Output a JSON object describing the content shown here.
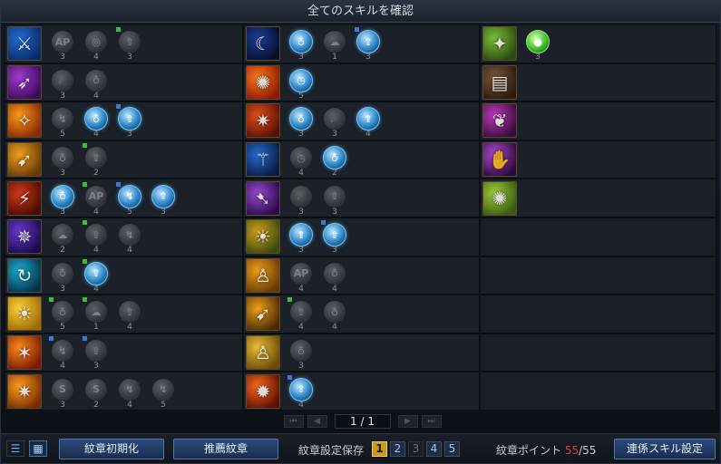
{
  "window": {
    "title": "全てのスキルを確認"
  },
  "skills": [
    {
      "icon": "blade-rush-icon",
      "glyph": "⚔",
      "bg": [
        "#1e6fd0",
        "#0b2a6a"
      ],
      "emblems": [
        {
          "s": "inactive",
          "c": "3",
          "t": "",
          "g": "AP"
        },
        {
          "s": "inactive",
          "c": "4",
          "t": "",
          "g": "◎"
        },
        {
          "s": "inactive",
          "c": "3",
          "t": "g",
          "g": "⇧"
        }
      ]
    },
    {
      "icon": "crescent-moon-icon",
      "glyph": "☾",
      "bg": [
        "#1c3f9a",
        "#070d2a"
      ],
      "emblems": [
        {
          "s": "active",
          "c": "3",
          "t": "",
          "g": "♁"
        },
        {
          "s": "inactive",
          "c": "1",
          "t": "",
          "g": "☁"
        },
        {
          "s": "active",
          "c": "3",
          "t": "b",
          "g": "⇧"
        }
      ]
    },
    {
      "icon": "nature-spirit-icon",
      "glyph": "✦",
      "bg": [
        "#7bbf3a",
        "#2a4a10"
      ],
      "emblems": [
        {
          "s": "green",
          "c": "3",
          "t": "",
          "g": "●"
        }
      ]
    },
    {
      "icon": "shadow-dash-icon",
      "glyph": "➶",
      "bg": [
        "#a03ad0",
        "#3a0c5a"
      ],
      "emblems": [
        {
          "s": "inactive",
          "c": "3",
          "t": "",
          "g": "☄"
        },
        {
          "s": "inactive",
          "c": "4",
          "t": "",
          "g": "♁"
        }
      ]
    },
    {
      "icon": "fire-sun-icon",
      "glyph": "✺",
      "bg": [
        "#ff7a1a",
        "#8a1a04"
      ],
      "emblems": [
        {
          "s": "active",
          "c": "5",
          "t": "",
          "g": "◷"
        }
      ]
    },
    {
      "icon": "spellbook-icon",
      "glyph": "▤",
      "bg": [
        "#7a5a3a",
        "#2a1a10"
      ],
      "emblems": []
    },
    {
      "icon": "flame-kick-icon",
      "glyph": "✧",
      "bg": [
        "#ff9a1a",
        "#8a2a04"
      ],
      "emblems": [
        {
          "s": "inactive",
          "c": "5",
          "t": "",
          "g": "↯"
        },
        {
          "s": "active",
          "c": "4",
          "t": "",
          "g": "♁"
        },
        {
          "s": "active",
          "c": "3",
          "t": "b",
          "g": "⇧"
        }
      ]
    },
    {
      "icon": "flame-leap-icon",
      "glyph": "✷",
      "bg": [
        "#e0501a",
        "#5a1004"
      ],
      "emblems": [
        {
          "s": "active",
          "c": "3",
          "t": "",
          "g": "♁"
        },
        {
          "s": "inactive",
          "c": "3",
          "t": "",
          "g": "☄"
        },
        {
          "s": "active",
          "c": "4",
          "t": "",
          "g": "⇑"
        }
      ]
    },
    {
      "icon": "dark-wings-icon",
      "glyph": "❦",
      "bg": [
        "#c03ac0",
        "#3a0a3a"
      ],
      "emblems": []
    },
    {
      "icon": "golden-strike-icon",
      "glyph": "➹",
      "bg": [
        "#f0a020",
        "#6a3a04"
      ],
      "emblems": [
        {
          "s": "inactive",
          "c": "3",
          "t": "",
          "g": "♁"
        },
        {
          "s": "inactive",
          "c": "2",
          "t": "g",
          "g": "⇧"
        }
      ]
    },
    {
      "icon": "pole-spin-icon",
      "glyph": "⚚",
      "bg": [
        "#2a6ad0",
        "#081a40"
      ],
      "emblems": [
        {
          "s": "inactive",
          "c": "4",
          "t": "",
          "g": "◷"
        },
        {
          "s": "active",
          "c": "2",
          "t": "",
          "g": "♁"
        }
      ]
    },
    {
      "icon": "shadow-grab-icon",
      "glyph": "✋",
      "bg": [
        "#b04ad0",
        "#2a0a3a"
      ],
      "emblems": []
    },
    {
      "icon": "crimson-slash-icon",
      "glyph": "⚡",
      "bg": [
        "#d03a1a",
        "#4a0a04"
      ],
      "emblems": [
        {
          "s": "active",
          "c": "3",
          "t": "",
          "g": "♁"
        },
        {
          "s": "inactive",
          "c": "4",
          "t": "g",
          "g": "AP"
        },
        {
          "s": "active",
          "c": "5",
          "t": "b",
          "g": "↯"
        },
        {
          "s": "active",
          "c": "3",
          "t": "",
          "g": "⇧"
        }
      ]
    },
    {
      "icon": "violet-kick-icon",
      "glyph": "➷",
      "bg": [
        "#9a4ad0",
        "#2a0a4a"
      ],
      "emblems": [
        {
          "s": "inactive",
          "c": "3",
          "t": "",
          "g": "☄"
        },
        {
          "s": "inactive",
          "c": "3",
          "t": "",
          "g": "⇧"
        }
      ]
    },
    {
      "icon": "radiant-burst-icon",
      "glyph": "✺",
      "bg": [
        "#a0d03a",
        "#3a5a10"
      ],
      "emblems": []
    },
    {
      "icon": "purple-spiral-icon",
      "glyph": "✵",
      "bg": [
        "#6a3ad0",
        "#1a0a4a"
      ],
      "emblems": [
        {
          "s": "inactive",
          "c": "2",
          "t": "",
          "g": "☁"
        },
        {
          "s": "inactive",
          "c": "4",
          "t": "g",
          "g": "⇧"
        },
        {
          "s": "inactive",
          "c": "4",
          "t": "",
          "g": "↯"
        }
      ]
    },
    {
      "icon": "golden-aura-icon",
      "glyph": "☀",
      "bg": [
        "#d0a01a",
        "#3a4a10"
      ],
      "emblems": [
        {
          "s": "active",
          "c": "3",
          "t": "",
          "g": "⇑"
        },
        {
          "s": "active",
          "c": "3",
          "t": "b",
          "g": "⇧"
        }
      ]
    },
    {
      "icon": "empty-slot",
      "glyph": "",
      "bg": null,
      "emblems": []
    },
    {
      "icon": "aqua-flip-icon",
      "glyph": "↻",
      "bg": [
        "#1ab0d0",
        "#04304a"
      ],
      "emblems": [
        {
          "s": "inactive",
          "c": "3",
          "t": "",
          "g": "♁"
        },
        {
          "s": "active",
          "c": "4",
          "t": "g",
          "g": "⇧"
        }
      ]
    },
    {
      "icon": "golden-figure-icon",
      "glyph": "♙",
      "bg": [
        "#f0a01a",
        "#6a3a04"
      ],
      "emblems": [
        {
          "s": "inactive",
          "c": "4",
          "t": "",
          "g": "AP"
        },
        {
          "s": "inactive",
          "c": "4",
          "t": "",
          "g": "♁"
        }
      ]
    },
    {
      "icon": "empty-slot",
      "glyph": "",
      "bg": null,
      "emblems": []
    },
    {
      "icon": "sun-orb-icon",
      "glyph": "☀",
      "bg": [
        "#ffd23a",
        "#a06a04"
      ],
      "emblems": [
        {
          "s": "inactive",
          "c": "5",
          "t": "g",
          "g": "♁"
        },
        {
          "s": "inactive",
          "c": "1",
          "t": "g",
          "g": "☁"
        },
        {
          "s": "inactive",
          "c": "4",
          "t": "",
          "g": "⇧"
        }
      ]
    },
    {
      "icon": "golden-rush-icon",
      "glyph": "➹",
      "bg": [
        "#f0a01a",
        "#4a2a04"
      ],
      "emblems": [
        {
          "s": "inactive",
          "c": "4",
          "t": "g",
          "g": "⇧"
        },
        {
          "s": "inactive",
          "c": "4",
          "t": "",
          "g": "♁"
        }
      ]
    },
    {
      "icon": "empty-slot",
      "glyph": "",
      "bg": null,
      "emblems": []
    },
    {
      "icon": "flame-sweep-icon",
      "glyph": "✶",
      "bg": [
        "#ff8a1a",
        "#7a1a04"
      ],
      "emblems": [
        {
          "s": "inactive",
          "c": "4",
          "t": "b",
          "g": "↯"
        },
        {
          "s": "inactive",
          "c": "3",
          "t": "b",
          "g": "⇧"
        }
      ]
    },
    {
      "icon": "golden-glow-icon",
      "glyph": "♙",
      "bg": [
        "#f0c03a",
        "#6a4a04"
      ],
      "emblems": [
        {
          "s": "inactive",
          "c": "3",
          "t": "",
          "g": "♁"
        }
      ]
    },
    {
      "icon": "empty-slot",
      "glyph": "",
      "bg": null,
      "emblems": []
    },
    {
      "icon": "blaze-combo-icon",
      "glyph": "✷",
      "bg": [
        "#ffa01a",
        "#7a2a04"
      ],
      "emblems": [
        {
          "s": "inactive",
          "c": "3",
          "t": "",
          "g": "S"
        },
        {
          "s": "inactive",
          "c": "2",
          "t": "",
          "g": "S"
        },
        {
          "s": "inactive",
          "c": "4",
          "t": "",
          "g": "↯"
        },
        {
          "s": "inactive",
          "c": "5",
          "t": "",
          "g": "↯"
        }
      ]
    },
    {
      "icon": "meteor-burst-icon",
      "glyph": "✹",
      "bg": [
        "#ff6a1a",
        "#5a1004"
      ],
      "emblems": [
        {
          "s": "active",
          "c": "4",
          "t": "b",
          "g": "⇧"
        }
      ]
    },
    {
      "icon": "empty-slot",
      "glyph": "",
      "bg": null,
      "emblems": []
    }
  ],
  "pager": {
    "label": "1 / 1",
    "first": "⏮",
    "prev": "◀",
    "next": "▶",
    "last": "⏭"
  },
  "bottom": {
    "list_view_icon": "☰",
    "grid_view_icon": "▦",
    "reset_label": "紋章初期化",
    "recommend_label": "推薦紋章",
    "save_label": "紋章設定保存",
    "presets": [
      "1",
      "2",
      "3",
      "4",
      "5"
    ],
    "points_label": "紋章ポイント",
    "points_current": "55",
    "points_separator": "/",
    "points_max": "55",
    "link_skill_label": "連係スキル設定"
  }
}
